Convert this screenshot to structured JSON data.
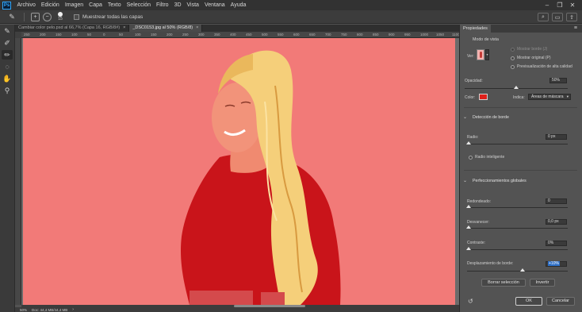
{
  "app": {
    "logo": "Ps"
  },
  "menu": [
    "Archivo",
    "Edición",
    "Imagen",
    "Capa",
    "Texto",
    "Selección",
    "Filtro",
    "3D",
    "Vista",
    "Ventana",
    "Ayuda"
  ],
  "options": {
    "brush_size": "15",
    "show_all_layers": "Muestrear todas las capas"
  },
  "tabs": [
    {
      "label": "Cambiar color pelo.psd al 66,7% (Capa 16, RGB/8#)",
      "close": "×"
    },
    {
      "label": "_DSC0153.jpg al 50% (RGB/8)",
      "close": "×"
    }
  ],
  "ruler_ticks": [
    "250",
    "200",
    "150",
    "100",
    "50",
    "0",
    "50",
    "100",
    "150",
    "200",
    "250",
    "300",
    "350",
    "400",
    "450",
    "500",
    "550",
    "600",
    "650",
    "700",
    "750",
    "800",
    "850",
    "900",
    "950",
    "1000",
    "1050",
    "1100"
  ],
  "status": {
    "zoom": "50%",
    "doc": "Doc: 44,4 MB/44,4 MB",
    "arrow": "›"
  },
  "panel": {
    "title": "Propiedades",
    "view_mode": "Modo de vista",
    "view_label": "Ver:",
    "show_edge": "Mostrar borde (J)",
    "show_original": "Mostrar original (P)",
    "hq_preview": "Previsualización de alta calidad",
    "opacity_label": "Opacidad:",
    "opacity_value": "50%",
    "opacity_level": 0.5,
    "color_label": "Color:",
    "color_value": "#e0201b",
    "indicates_label": "Indica:",
    "indicates_value": "Áreas de máscara",
    "edge_detection": "Detección de borde",
    "radius_label": "Radio:",
    "radius_value": "0 px",
    "smart_radius": "Radio inteligente",
    "global_refinements": "Perfeccionamientos globales",
    "smooth_label": "Redondeado:",
    "smooth_value": "0",
    "feather_label": "Desvanecer:",
    "feather_value": "0,0 px",
    "contrast_label": "Contraste:",
    "contrast_value": "0%",
    "shift_edge_label": "Desplazamiento de borde:",
    "shift_edge_value": "+10%",
    "clear_selection": "Borrar selección",
    "invert": "Invertir",
    "ok": "OK",
    "cancel": "Cancelar"
  }
}
